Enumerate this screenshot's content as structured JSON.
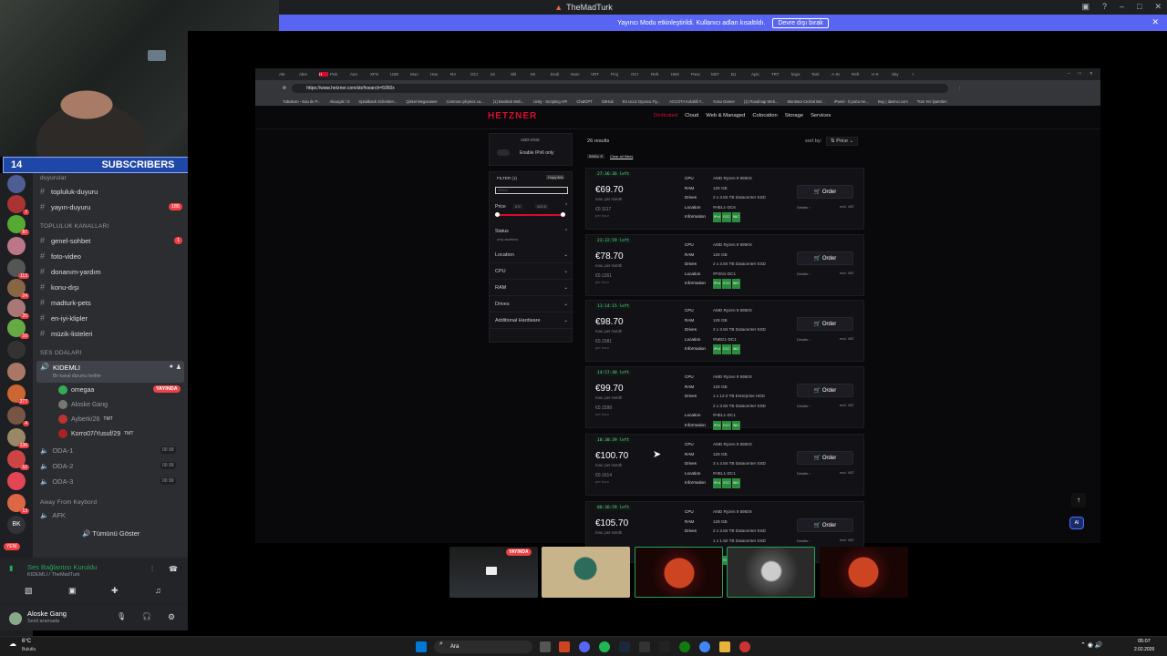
{
  "window": {
    "title": "TheMadTurk"
  },
  "banner": {
    "text": "Yayıncı Modu etkinleştirildi. Kullanıcı adları kısaltıldı.",
    "button": "Devre dışı bırak"
  },
  "subscribers": {
    "left": "14",
    "label": "SUBSCRIBERS",
    "right": "10"
  },
  "server_badges": [
    "7",
    "87",
    "113",
    "24",
    "20",
    "10",
    "377",
    "4",
    "136",
    "62",
    "13"
  ],
  "channels": {
    "cat_top": "duyurular",
    "items_top": [
      {
        "name": "topluluk-duyuru",
        "badge": ""
      },
      {
        "name": "yayın-duyuru",
        "badge": "185"
      }
    ],
    "cat_community": "TOPLULUK KANALLARI",
    "items": [
      {
        "name": "genel-sohbet",
        "badge": "1"
      },
      {
        "name": "foto-video",
        "badge": ""
      },
      {
        "name": "donanım-yardım",
        "badge": ""
      },
      {
        "name": "konu-dışı",
        "badge": ""
      },
      {
        "name": "madturk-pets",
        "badge": ""
      },
      {
        "name": "en-iyi-klipler",
        "badge": ""
      },
      {
        "name": "müzik-listeleri",
        "badge": ""
      }
    ],
    "cat_voice": "SES ODALARI",
    "voice_selected": {
      "name": "KIDEMLI",
      "status": "Bir kanal durumu belirle",
      "live": "YAYINDA"
    },
    "voice_users": [
      {
        "name": "omegaa",
        "tag": "",
        "live": "YAYINDA"
      },
      {
        "name": "Aloske Gang",
        "tag": "",
        "live": ""
      },
      {
        "name": "Ayberk/26",
        "tag": "TMT",
        "live": ""
      },
      {
        "name": "Korro07/Yusuf/29",
        "tag": "TMT",
        "live": ""
      }
    ],
    "rooms": [
      {
        "name": "ODA-1",
        "count_a": "00",
        "count_b": "99"
      },
      {
        "name": "ODA-2",
        "count_a": "00",
        "count_b": "99"
      },
      {
        "name": "ODA-3",
        "count_a": "00",
        "count_b": "99"
      }
    ],
    "cat_afk": "Away From Keybord",
    "afk": "AFK",
    "show_all": "Tümünü Göster",
    "new_badge": "YENİ"
  },
  "voice_panel": {
    "status": "Ses Bağlantısı Kuruldu",
    "channel": "KIDEMLI / TheMadTurk"
  },
  "user_panel": {
    "name": "Aloske Gang",
    "status": "Sesli aramada",
    "server_label": "BK"
  },
  "browser": {
    "url": "https://www.hetzner.com/sb/#search=5950x",
    "tabs": [
      "Akt",
      "Alen",
      "H",
      "Pub",
      "Ann",
      "XFO",
      "USE",
      "Mon",
      "Has",
      "RA",
      "OCI",
      "Ist",
      "Skl",
      "MI",
      "Endi",
      "Nam",
      "VRT",
      "Proj",
      "OCI",
      "Refr",
      "HEK",
      "Panc",
      "M27",
      "B1",
      "Apic",
      "TRT",
      "kaye",
      "Tarti",
      "A-St",
      "Refr",
      "H-K",
      "Sky"
    ],
    "bookmarks": [
      "Yabukuro - Eau de P...",
      "Akauçak / 8",
      "Spitalbank Schreiber...",
      "Qiskel Megacases",
      "Common physics ca...",
      "(1) Bookluk Web...",
      "Unity - Scripting API",
      "ChatGPT",
      "GitHub",
      "En Ucuz Oyuncu Fiy...",
      "ACCOTA Kolaltili Y...",
      "Kosu Gamer",
      "(1) Roadmap Web...",
      "Monitora Ceziral Bol...",
      "iPanel - Il porta He...",
      "Buy | davinci.com",
      "Tüm Yer İşaretleri"
    ]
  },
  "hetzner": {
    "logo": "HETZNER",
    "nav": [
      "Dedicated",
      "Cloud",
      "Web & Managed",
      "Colocation",
      "Storage",
      "Services"
    ],
    "addons": "ADD-ONS",
    "ipv6": "Enable IPv6 only",
    "filter": "FILTER (1)",
    "copy_link": "Copy link",
    "filter_chip": "5950x",
    "price_label": "Price",
    "price_min": "0.5",
    "price_max": "400.5",
    "status_label": "Status",
    "status_sub": "only auctions",
    "filters": [
      "Location",
      "CPU",
      "RAM",
      "Drives",
      "Additional Hardware"
    ],
    "results_count": "26 results",
    "sort_by": "sort by:",
    "sort_value": "Price",
    "chip": "5950x",
    "clear_filters": "Clear all filters",
    "spec_keys": [
      "CPU",
      "RAM",
      "Drives",
      "Location",
      "Information"
    ],
    "info_tags": [
      "IPv4",
      "ECC",
      "INIC"
    ],
    "order": "Order",
    "details": "Details",
    "vat": "excl. VAT",
    "per_month": "max. per month",
    "per_hour": "per hour",
    "results": [
      {
        "timer": "27:36:36 left",
        "price": "€69.70",
        "hourly": "€0.1117",
        "cpu": "AMD Ryzen 9 5950X",
        "ram": "128 GB",
        "drives": [
          "2 x 3.84 TB Datacenter SSD"
        ],
        "location": "#HEL1-DC6"
      },
      {
        "timer": "23:22:59 left",
        "price": "€78.70",
        "hourly": "€0.1261",
        "cpu": "AMD Ryzen 9 5950X",
        "ram": "128 GB",
        "drives": [
          "2 x 3.84 TB Datacenter SSD"
        ],
        "location": "#FSN1-DC1"
      },
      {
        "timer": "11:14:15 left",
        "price": "€98.70",
        "hourly": "€0.1581",
        "cpu": "AMD Ryzen 9 5950X",
        "ram": "128 GB",
        "drives": [
          "2 x 3.84 TB Datacenter SSD"
        ],
        "location": "#NBG1-DC1"
      },
      {
        "timer": "14:57:40 left",
        "price": "€99.70",
        "hourly": "€0.1598",
        "cpu": "AMD Ryzen 9 5950X",
        "ram": "128 GB",
        "drives": [
          "1 x 12.0 TB Enterprise HDD",
          "2 x 3.84 TB Datacenter SSD"
        ],
        "location": "#HEL1-DC1"
      },
      {
        "timer": "10:30:39 left",
        "price": "€100.70",
        "hourly": "€0.1614",
        "cpu": "AMD Ryzen 9 5950X",
        "ram": "128 GB",
        "drives": [
          "3 x 3.84 TB Datacenter SSD"
        ],
        "location": "#HEL1-DC1"
      },
      {
        "timer": "06:36:59 left",
        "price": "€105.70",
        "hourly": "",
        "cpu": "AMD Ryzen 9 5950X",
        "ram": "128 GB",
        "drives": [
          "2 x 3.84 TB Datacenter SSD",
          "1 x 1.92 TB Datacenter SSD"
        ],
        "location": ""
      }
    ]
  },
  "stream_thumbs": [
    {
      "live": "YAYINDA"
    },
    {
      "live": ""
    },
    {
      "live": ""
    },
    {
      "live": ""
    },
    {
      "live": ""
    }
  ],
  "taskbar": {
    "weather_temp": "6°C",
    "weather_text": "Bulutlu",
    "search": "Ara",
    "time": "05:07",
    "date": "2.02.2026"
  },
  "colors": {
    "discord_blurple": "#5865f2",
    "hetzner_red": "#d50c2d",
    "live_red": "#ed4245",
    "tag_green": "#2b8a3e"
  }
}
